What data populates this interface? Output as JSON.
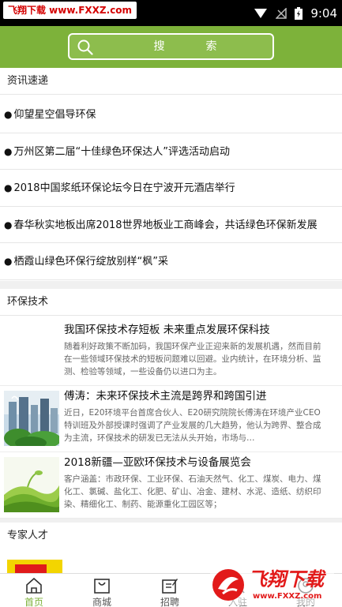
{
  "status_bar": {
    "watermark": "飞翔下载 www.FXXZ.com",
    "time": "9:04",
    "icons": [
      "wifi-icon",
      "no-signal-icon",
      "battery-icon"
    ]
  },
  "header": {
    "search_placeholder": "搜索",
    "colors": {
      "accent": "#7db23a"
    }
  },
  "news": {
    "title": "资讯速递",
    "items": [
      "仰望星空倡导环保",
      "万州区第二届“十佳绿色环保达人”评选活动启动",
      "2018中国浆纸环保论坛今日在宁波开元酒店举行",
      "春华秋实地板出席2018世界地板业工商峰会，共话绿色环保新发展",
      "栖霞山绿色环保行绽放别样“枫”采"
    ]
  },
  "tech": {
    "title": "环保技术",
    "items": [
      {
        "title": "我国环保技术存短板 未来重点发展环保科技",
        "desc": "随着利好政策不断加码，我国环保产业正迎来新的发展机遇，然而目前在一些领域环保技术的短板问题难以回避。业内统计，在环境分析、监测、检验等领域，一些设备仍以进口为主。",
        "thumb": "none"
      },
      {
        "title": "傅涛：未来环保技术主流是跨界和跨国引进",
        "desc": "近日，E20环境平台首席合伙人、E20研究院院长傅涛在环境产业CEO特训班及外部授课时强调了产业发展的几大趋势，他认为跨界、整合成为主流，环保技术的研发已无法从头开始，市场与…",
        "thumb": "city-green-image"
      },
      {
        "title": "2018新疆—亚欧环保技术与设备展览会",
        "desc": "客户涵盖：市政环保、工业环保、石油天然气、化工、煤炭、电力、煤化工、氯碱、盐化工、化肥、矿山、冶金、建材、水泥、造纸、纺织印染、精细化工、制药、能源重化工园区等；",
        "thumb": "green-wave-image"
      }
    ]
  },
  "experts": {
    "title": "专家人才"
  },
  "tabs": [
    {
      "label": "首页",
      "icon": "home-icon",
      "active": true
    },
    {
      "label": "商城",
      "icon": "bag-icon",
      "active": false
    },
    {
      "label": "招聘",
      "icon": "edit-icon",
      "active": false
    },
    {
      "label": "入驻",
      "icon": "user-icon",
      "active": false
    },
    {
      "label": "我的",
      "icon": "profile-icon",
      "active": false
    }
  ],
  "footer_watermark": {
    "brand": "飞翔下载",
    "url": "www.FXXZ.com"
  }
}
